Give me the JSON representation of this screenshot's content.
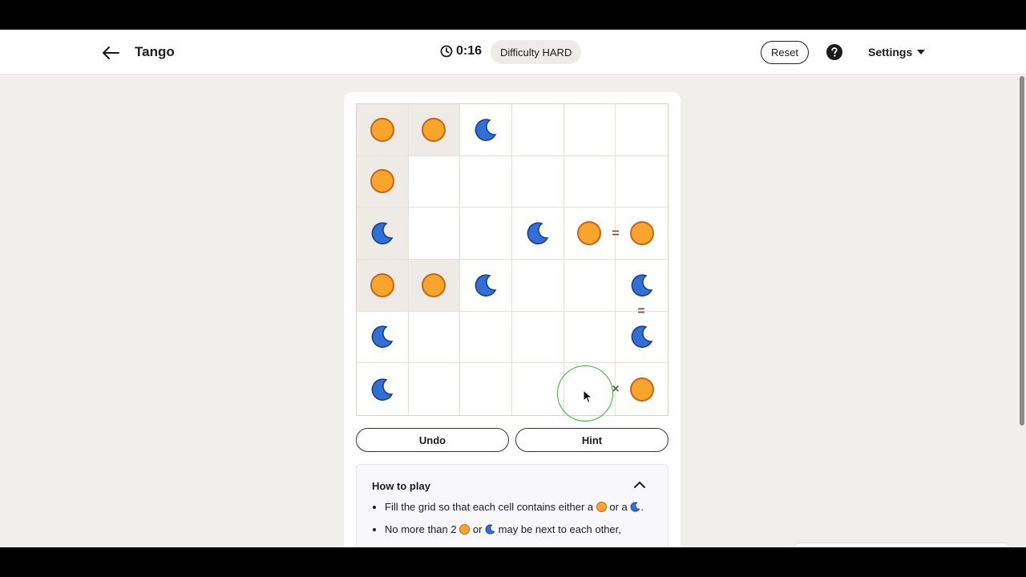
{
  "header": {
    "title": "Tango",
    "timer": "0:16",
    "difficulty": "Difficulty HARD",
    "reset_label": "Reset",
    "settings_label": "Settings"
  },
  "grid": {
    "rows": [
      [
        "sun",
        "sun",
        "moon",
        "",
        "",
        ""
      ],
      [
        "sun",
        "",
        "",
        "",
        "",
        ""
      ],
      [
        "moon",
        "",
        "",
        "moon",
        "sun",
        "sun"
      ],
      [
        "sun",
        "sun",
        "moon",
        "",
        "",
        "moon"
      ],
      [
        "moon",
        "",
        "",
        "",
        "",
        "moon"
      ],
      [
        "moon",
        "",
        "",
        "",
        "",
        "sun"
      ]
    ],
    "locked": [
      [
        true,
        true,
        false,
        false,
        false,
        false
      ],
      [
        true,
        false,
        false,
        false,
        false,
        false
      ],
      [
        true,
        false,
        false,
        false,
        false,
        false
      ],
      [
        true,
        true,
        false,
        false,
        false,
        false
      ],
      [
        false,
        false,
        false,
        false,
        false,
        false
      ],
      [
        false,
        false,
        false,
        false,
        false,
        false
      ]
    ],
    "constraints": [
      {
        "symbol": "=",
        "between": "r2c4-r2c5"
      },
      {
        "symbol": "=",
        "between": "r3c5-r4c5"
      },
      {
        "symbol": "×",
        "between": "r5c4-r5c5"
      }
    ]
  },
  "actions": {
    "undo_label": "Undo",
    "hint_label": "Hint"
  },
  "how_to_play": {
    "title": "How to play",
    "rule1_prefix": "Fill the grid so that each cell contains either a",
    "rule1_or": "or a",
    "rule1_suffix": ".",
    "rule2_prefix": "No more than 2",
    "rule2_or": "or",
    "rule2_suffix": "may be next to each other,"
  },
  "colors": {
    "sun_fill": "#f7a52b",
    "sun_stroke": "#c9631a",
    "moon_fill": "#2f6fd6",
    "moon_stroke": "#1b3f8a",
    "locked_cell": "#eeeae6",
    "cursor_ring": "#2fb62f"
  }
}
